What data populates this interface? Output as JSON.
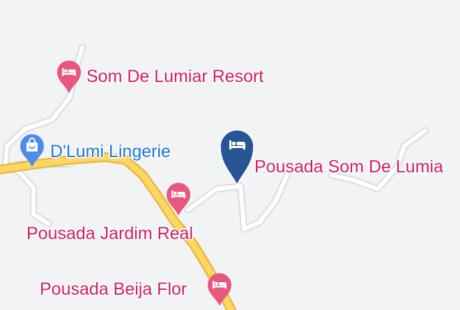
{
  "map": {
    "background_color": "#f1f3f4",
    "road_color": "#ffffff",
    "road_outline_color": "#dadce0",
    "highway_fill_color": "#fdd663",
    "highway_outline_color": "#e8b942"
  },
  "places": [
    {
      "id": "som-de-lumiar-resort",
      "name": "Som De Lumiar Resort",
      "category": "hotel",
      "icon": "bed-icon",
      "color": "#e8577e",
      "selected": false
    },
    {
      "id": "d-lumi-lingerie",
      "name": "D'Lumi Lingerie",
      "category": "shopping",
      "icon": "shopping-bag-icon",
      "color": "#4e8de6",
      "selected": false
    },
    {
      "id": "pousada-som-de-lumiar",
      "name": "Pousada Som De Lumia",
      "category": "hotel",
      "icon": "bed-icon",
      "color": "#2a5594",
      "selected": true
    },
    {
      "id": "pousada-jardim-real",
      "name": "Pousada Jardim Real",
      "category": "hotel",
      "icon": "bed-icon",
      "color": "#e8577e",
      "selected": false
    },
    {
      "id": "pousada-beija-flor",
      "name": "Pousada Beija Flor",
      "category": "hotel",
      "icon": "bed-icon",
      "color": "#e8577e",
      "selected": false
    }
  ]
}
